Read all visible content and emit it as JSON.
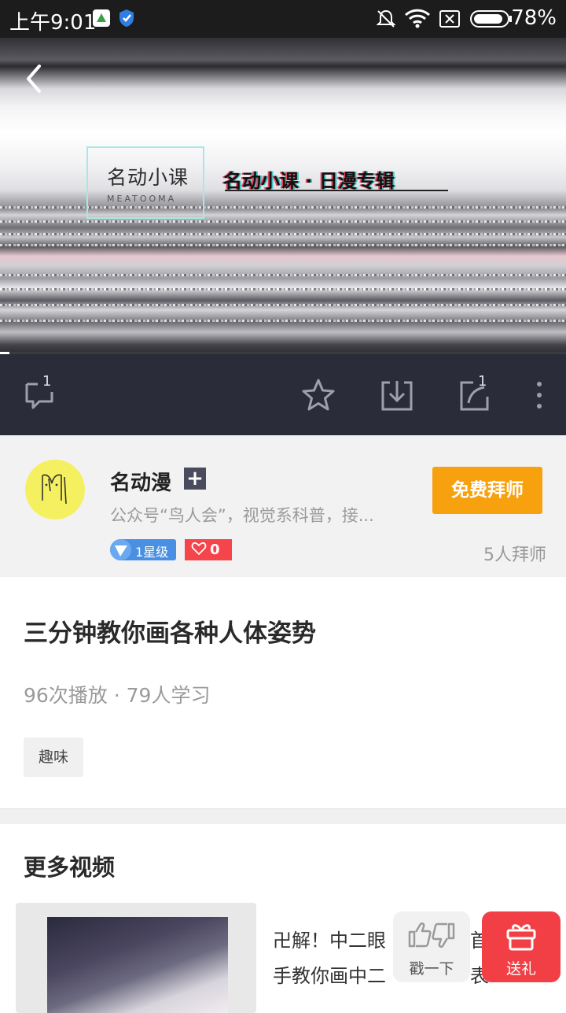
{
  "status_bar": {
    "time": "上午9:01",
    "battery": "78%"
  },
  "video": {
    "logo_main": "名动小课",
    "logo_sub": "MEATOOMA",
    "headline": "名动小课 · 日漫专辑"
  },
  "actions": {
    "comment_count": "1",
    "share_count": "1"
  },
  "author": {
    "name": "名动漫",
    "plus": "+",
    "description": "公众号“鸟人会”，视觉系科普，接...",
    "level": "1星级",
    "likes": "0",
    "follow_label": "免费拜师",
    "followers": "5人拜师"
  },
  "course": {
    "title": "三分钟教你画各种人体姿势",
    "stats": "96次播放 · 79人学习",
    "tag": "趣味"
  },
  "more_videos": {
    "heading": "更多视频",
    "items": [
      {
        "title_line1": "卍解！中二眼",
        "title_line2": "手教你画中二",
        "title_line1_tail": "首",
        "title_line2_tail": "表"
      }
    ]
  },
  "floating": {
    "poke_label": "戳一下",
    "gift_label": "送礼"
  },
  "colors": {
    "action_bar": "#2b2c3a",
    "follow_button": "#f8a10f",
    "gift_button": "#f23f46",
    "level_badge": "#4a90e2",
    "likes_badge": "#f5444a"
  }
}
